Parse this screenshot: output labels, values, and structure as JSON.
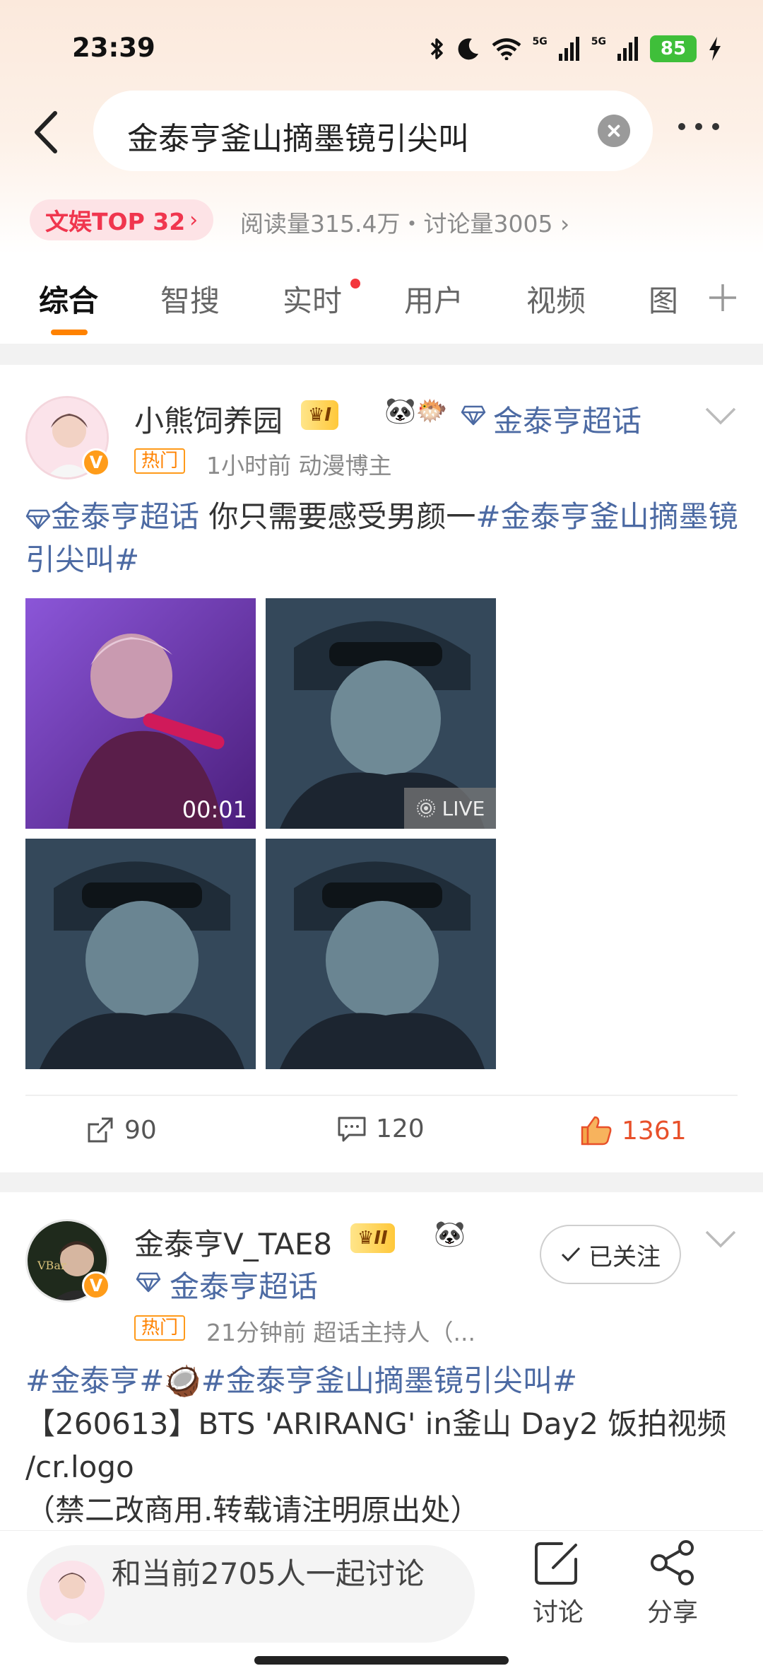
{
  "status_bar": {
    "time": "23:39",
    "battery": "85",
    "network_1": "5G",
    "network_2": "5G",
    "icons": [
      "bluetooth-icon",
      "moon-icon",
      "wifi-icon",
      "signal-icon",
      "signal-icon",
      "battery-icon",
      "charging-icon"
    ]
  },
  "search": {
    "query": "金泰亨釜山摘墨镜引尖叫"
  },
  "stats": {
    "rank_label": "文娱TOP 32",
    "rank_arrow": "›",
    "summary": "阅读量315.4万・讨论量3005 ›"
  },
  "tabs": [
    {
      "label": "综合",
      "active": true
    },
    {
      "label": "智搜"
    },
    {
      "label": "实时",
      "has_dot": true
    },
    {
      "label": "用户"
    },
    {
      "label": "视频"
    },
    {
      "label": "图"
    }
  ],
  "posts": [
    {
      "username": "小熊饲养园",
      "level_badge": "I",
      "emoji_badges": "🐼🐡",
      "super_topic": "金泰亨超话",
      "hot_tag": "热门",
      "meta": "1小时前   动漫博主",
      "text_topic": "金泰亨超话",
      "text_plain": " 你只需要感受男颜一",
      "text_hashtag": "#金泰亨釜山摘墨镜引尖叫#",
      "video_duration": "00:01",
      "live_label": "LIVE",
      "shares": "90",
      "comments": "120",
      "likes": "1361"
    },
    {
      "username": "金泰亨V_TAE8",
      "level_badge": "II",
      "emoji_badges": "🐼",
      "super_topic": "金泰亨超话",
      "follow_label": "已关注",
      "hot_tag": "热门",
      "meta": "21分钟前   超话主持人（...",
      "hashtag_1": "#金泰亨#",
      "emoji": "🥥",
      "hashtag_2": "#金泰亨釜山摘墨镜引尖叫#",
      "line_2": "【260613】BTS 'ARIRANG' in釜山 Day2 饭拍视频",
      "line_3": "/cr.logo",
      "line_4": "（禁二改商用.转载请注明原出处）"
    }
  ],
  "bottom_bar": {
    "discuss_prompt": "和当前2705人一起讨论",
    "discuss_label": "讨论",
    "share_label": "分享"
  },
  "colors": {
    "accent_orange": "#ff8200",
    "link_blue": "#4c6aa3",
    "rank_red": "#f0364e",
    "like_red": "#e8502a"
  }
}
